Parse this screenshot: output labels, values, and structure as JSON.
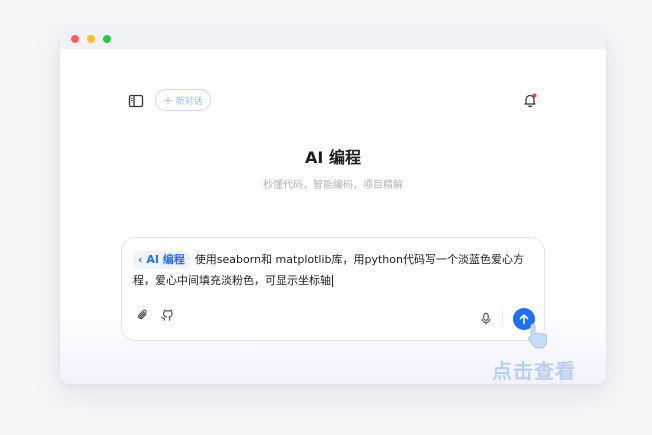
{
  "header": {
    "new_chat_label": "新对话",
    "new_chat_icon": "plus-icon",
    "sidebar_icon": "sidebar-toggle-icon",
    "bell_icon": "bell-icon"
  },
  "main": {
    "title": "AI 编程",
    "subtitle": "秒懂代码，智能编码，项目精解"
  },
  "input": {
    "tag_label": "AI 编程",
    "prompt_text": "使用seaborn和 matplotlib库，用python代码写一个淡蓝色爱心方程，爱心中间填充淡粉色，可显示坐标轴",
    "attach_icon": "paperclip-icon",
    "github_icon": "github-icon",
    "mic_icon": "microphone-icon",
    "send_icon": "arrow-up-icon"
  },
  "overlay": {
    "click_hint": "点击查看"
  },
  "colors": {
    "accent": "#1e6ff4",
    "tag_bg": "#eef3ff",
    "hint": "#b9cfee"
  }
}
